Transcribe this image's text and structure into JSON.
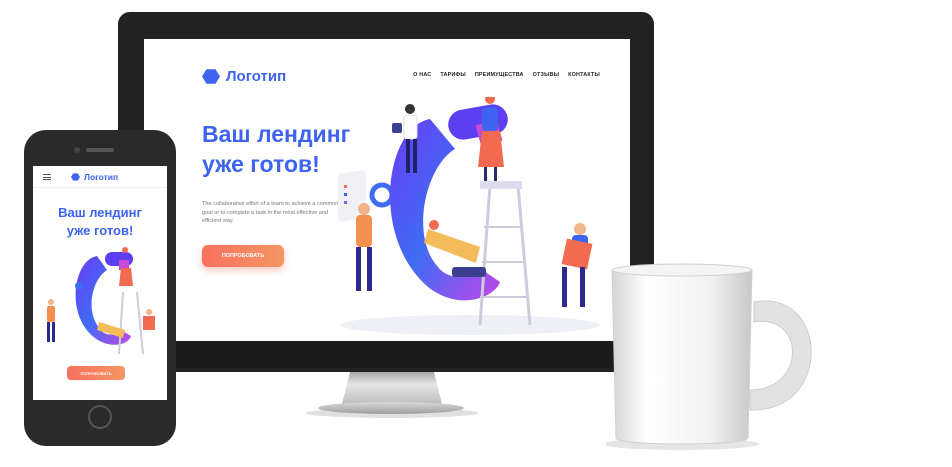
{
  "brand": {
    "logo_text": "Логотип",
    "accent": "#3d63f0",
    "cta_gradient": [
      "#f9705f",
      "#f49663"
    ]
  },
  "desktop": {
    "nav": [
      "О НАС",
      "ТАРИФЫ",
      "ПРЕИМУЩЕСТВА",
      "ОТЗЫВЫ",
      "КОНТАКТЫ"
    ],
    "headline_line1": "Ваш лендинг",
    "headline_line2": "уже готов!",
    "description": "The collaborative effort of a team to achieve a common goal or to complete a task in the most effective and efficient way.",
    "cta": "ПОПРОБОВАТЬ"
  },
  "mobile": {
    "menu_icon": "hamburger-icon",
    "headline_line1": "Ваш лендинг",
    "headline_line2": "уже готов!",
    "cta": "ПОПРОБОВАТЬ"
  }
}
